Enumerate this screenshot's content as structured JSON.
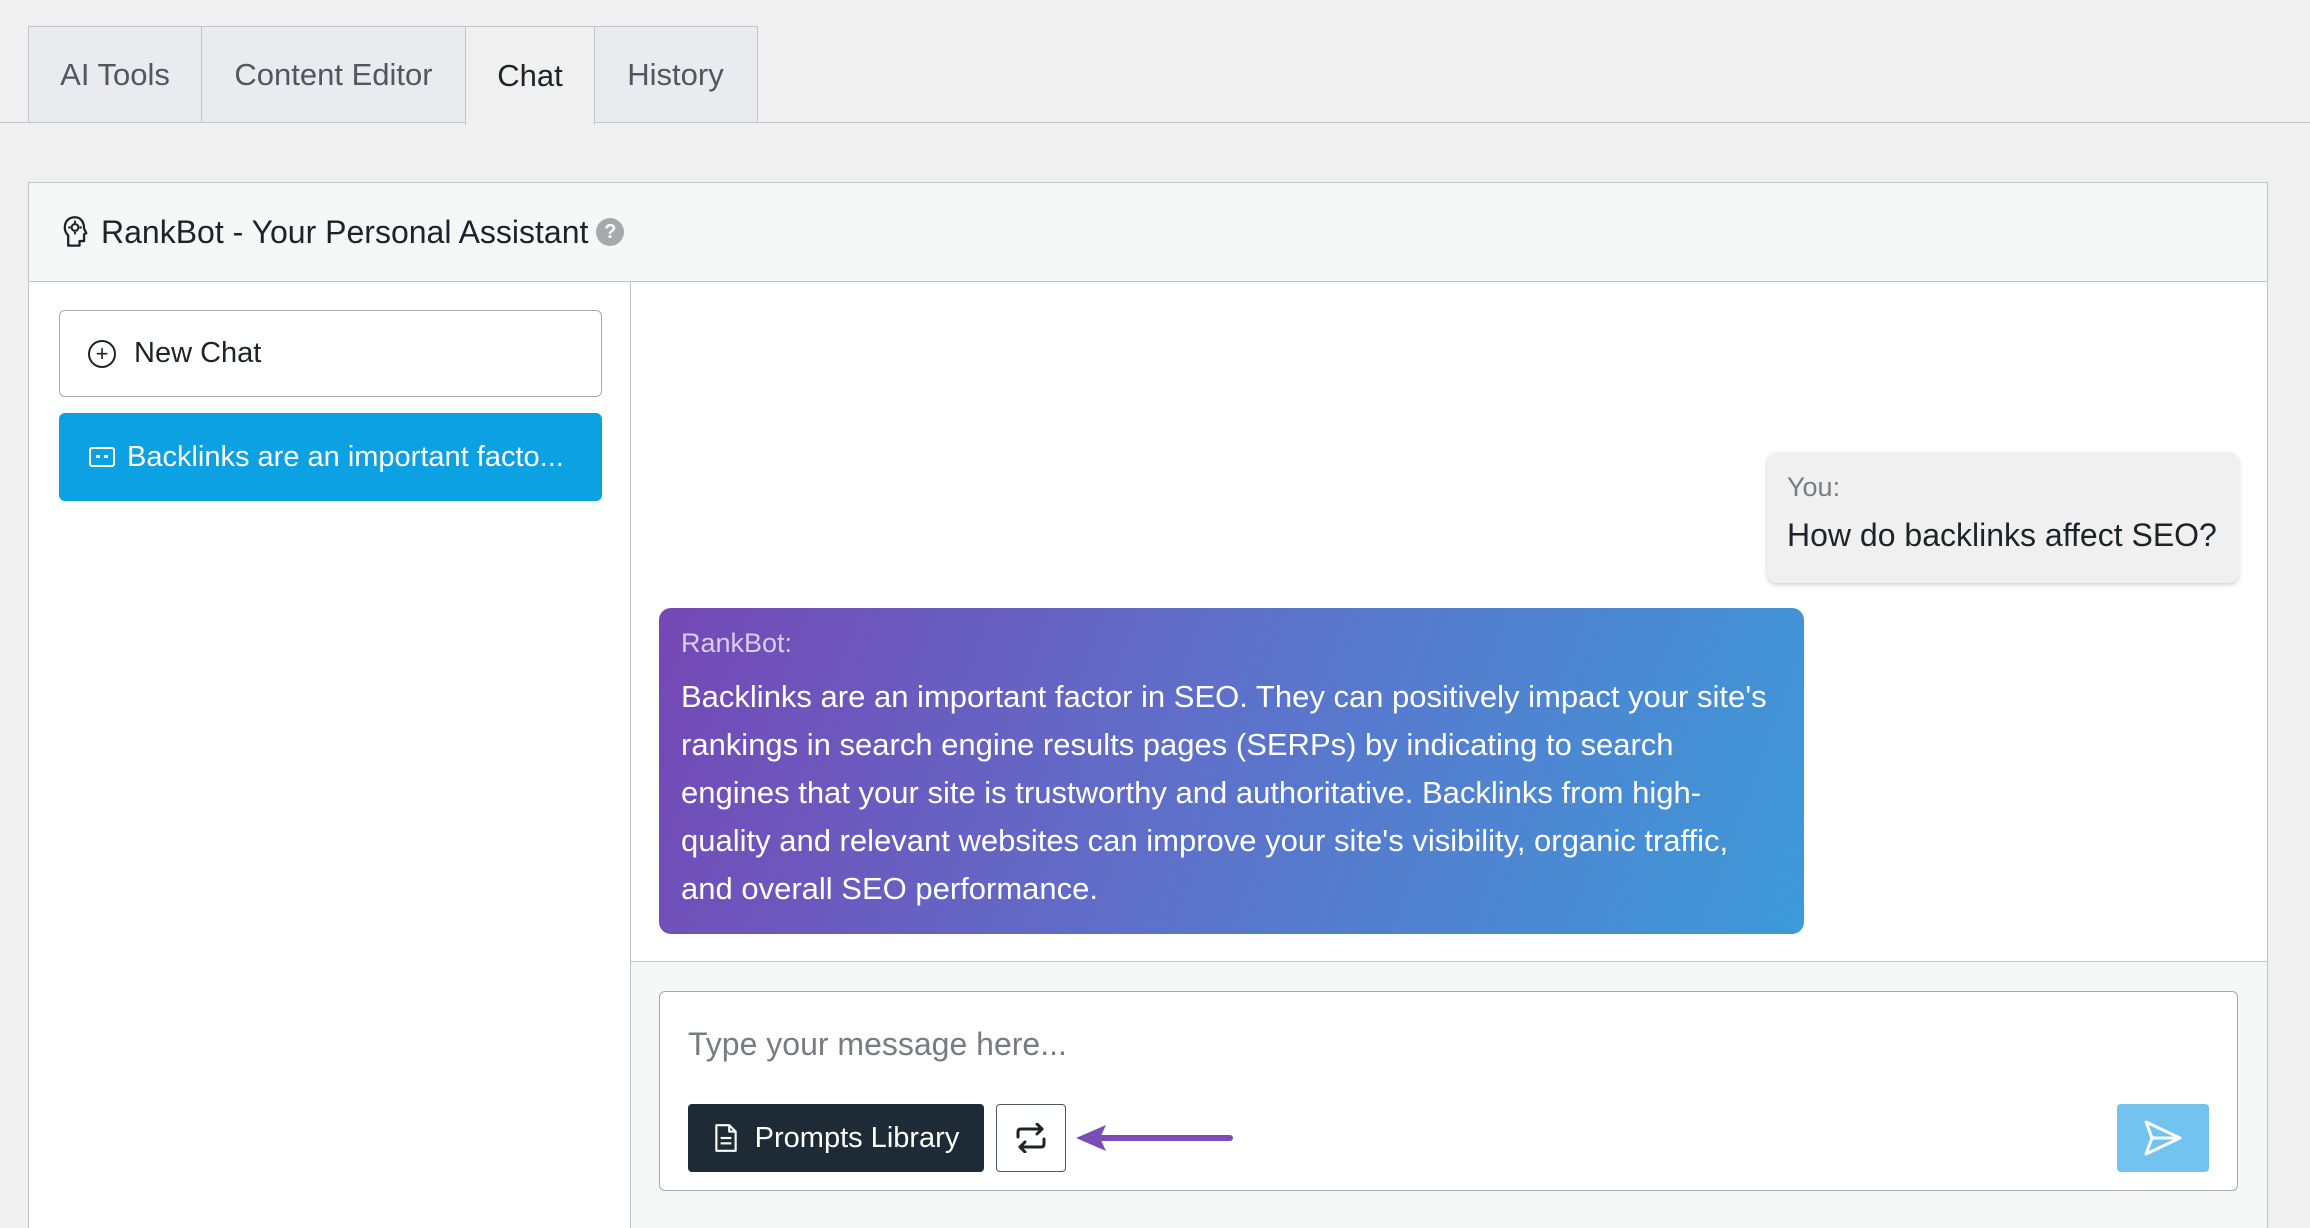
{
  "tabs": [
    {
      "label": "AI Tools"
    },
    {
      "label": "Content Editor"
    },
    {
      "label": "Chat"
    },
    {
      "label": "History"
    }
  ],
  "active_tab": "Chat",
  "panel": {
    "title": "RankBot - Your Personal Assistant",
    "help_glyph": "?"
  },
  "sidebar": {
    "new_chat_label": "New Chat",
    "chats": [
      {
        "label": "Backlinks are an important facto..."
      }
    ]
  },
  "messages": {
    "user": {
      "label": "You:",
      "text": "How do backlinks affect SEO?"
    },
    "bot": {
      "label": "RankBot:",
      "text": "Backlinks are an important factor in SEO. They can positively impact your site's rankings in search engine results pages (SERPs) by indicating to search engines that your site is trustworthy and authoritative. Backlinks from high-quality and relevant websites can improve your site's visibility, organic traffic, and overall SEO performance."
    }
  },
  "composer": {
    "placeholder": "Type your message here...",
    "prompts_library_label": "Prompts Library"
  },
  "icons": {
    "header": "robot-head-icon",
    "help": "help-icon",
    "new_chat": "plus-circle-icon",
    "chat_item": "message-icon",
    "prompts": "document-icon",
    "regenerate": "repeat-icon",
    "send": "send-icon"
  },
  "colors": {
    "accent": "#0ba1e2",
    "prompts_button": "#1d2b36",
    "send_button": "#72c3ef",
    "annotation_arrow": "#7b4bb8",
    "bot_gradient_start": "#7547b5",
    "bot_gradient_end": "#3d9ad9"
  }
}
